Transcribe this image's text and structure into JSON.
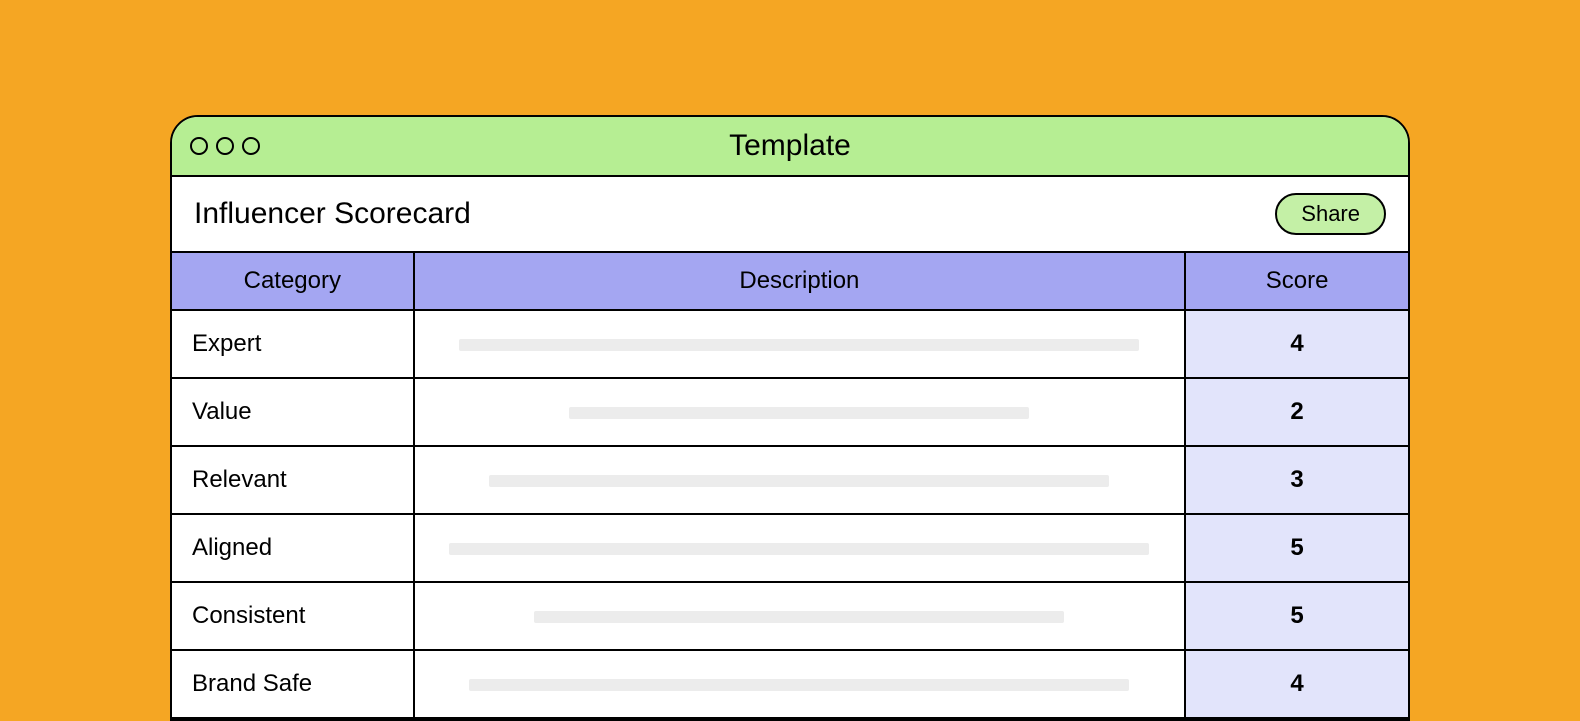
{
  "window": {
    "title": "Template"
  },
  "page": {
    "heading": "Influencer Scorecard",
    "share_label": "Share"
  },
  "table": {
    "headers": {
      "category": "Category",
      "description": "Description",
      "score": "Score"
    },
    "rows": [
      {
        "category": "Expert",
        "score": "4",
        "placeholder_width": 680
      },
      {
        "category": "Value",
        "score": "2",
        "placeholder_width": 460
      },
      {
        "category": "Relevant",
        "score": "3",
        "placeholder_width": 620
      },
      {
        "category": "Aligned",
        "score": "5",
        "placeholder_width": 700
      },
      {
        "category": "Consistent",
        "score": "5",
        "placeholder_width": 530
      },
      {
        "category": "Brand Safe",
        "score": "4",
        "placeholder_width": 660
      }
    ]
  }
}
